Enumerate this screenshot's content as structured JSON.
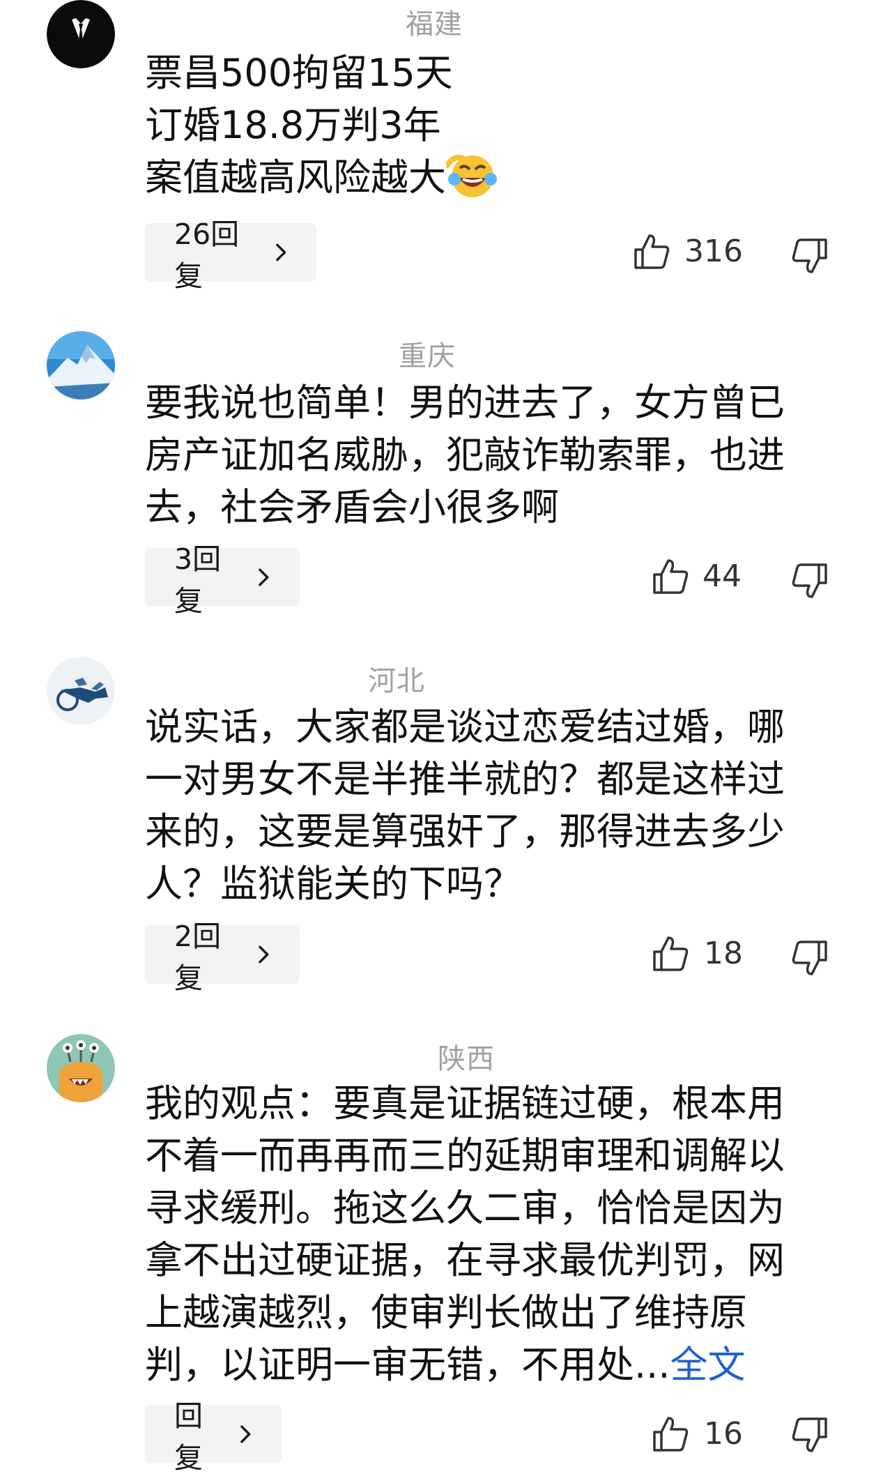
{
  "comments": [
    {
      "location": "福建",
      "lines": [
        "票昌500拘留15天",
        "订婚18.8万判3年",
        "案值越高风险越大"
      ],
      "emoji": "laughing-emoji",
      "replies": "26回复",
      "likes": "316"
    },
    {
      "location": "重庆",
      "lines": [
        "要我说也简单！男的进去了，女方曾已",
        "房产证加名威胁，犯敲诈勒索罪，也进",
        "去，社会矛盾会小很多啊"
      ],
      "replies": "3回复",
      "likes": "44"
    },
    {
      "location": "河北",
      "lines": [
        "说实话，大家都是谈过恋爱结过婚，哪",
        "一对男女不是半推半就的？都是这样过",
        "来的，这要是算强奸了，那得进去多少",
        "人？监狱能关的下吗？"
      ],
      "replies": "2回复",
      "likes": "18"
    },
    {
      "location": "陕西",
      "lines": [
        "我的观点：要真是证据链过硬，根本用",
        "不着一而再再而三的延期审理和调解以",
        "寻求缓刑。拖这么久二审，恰恰是因为",
        "拿不出过硬证据，在寻求最优判罚，网",
        "上越演越烈，使审判长做出了维持原",
        "判，以证明一审无错，不用处..."
      ],
      "full_text_link": "全文",
      "replies": "回复",
      "likes": "16"
    }
  ],
  "colors": {
    "location": "#a0a0a0",
    "link": "#1e63c9",
    "reply_bg": "#f3f3f3"
  }
}
